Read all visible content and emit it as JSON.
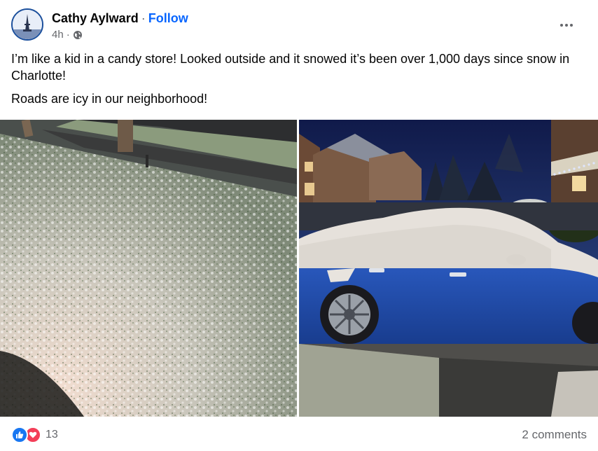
{
  "post": {
    "author": "Cathy Aylward",
    "separator": "·",
    "follow_label": "Follow",
    "time": "4h",
    "time_separator": "·",
    "audience_icon": "globe-icon",
    "body": [
      "I’m like a kid in a candy store! Looked outside and it snowed it’s been over 1,000 days since snow in Charlotte!",
      "Roads are icy in our neighborhood!"
    ],
    "photos": [
      {
        "description_icon": "snowy-lawn-photo"
      },
      {
        "description_icon": "snow-covered-car-photo"
      }
    ]
  },
  "footer": {
    "reaction_icons": [
      "like-icon",
      "love-icon"
    ],
    "reaction_count": "13",
    "comments": "2 comments"
  },
  "colors": {
    "accent": "#0866ff",
    "secondary_text": "#65676b",
    "like": "#1877f2",
    "love": "#f33e58"
  }
}
